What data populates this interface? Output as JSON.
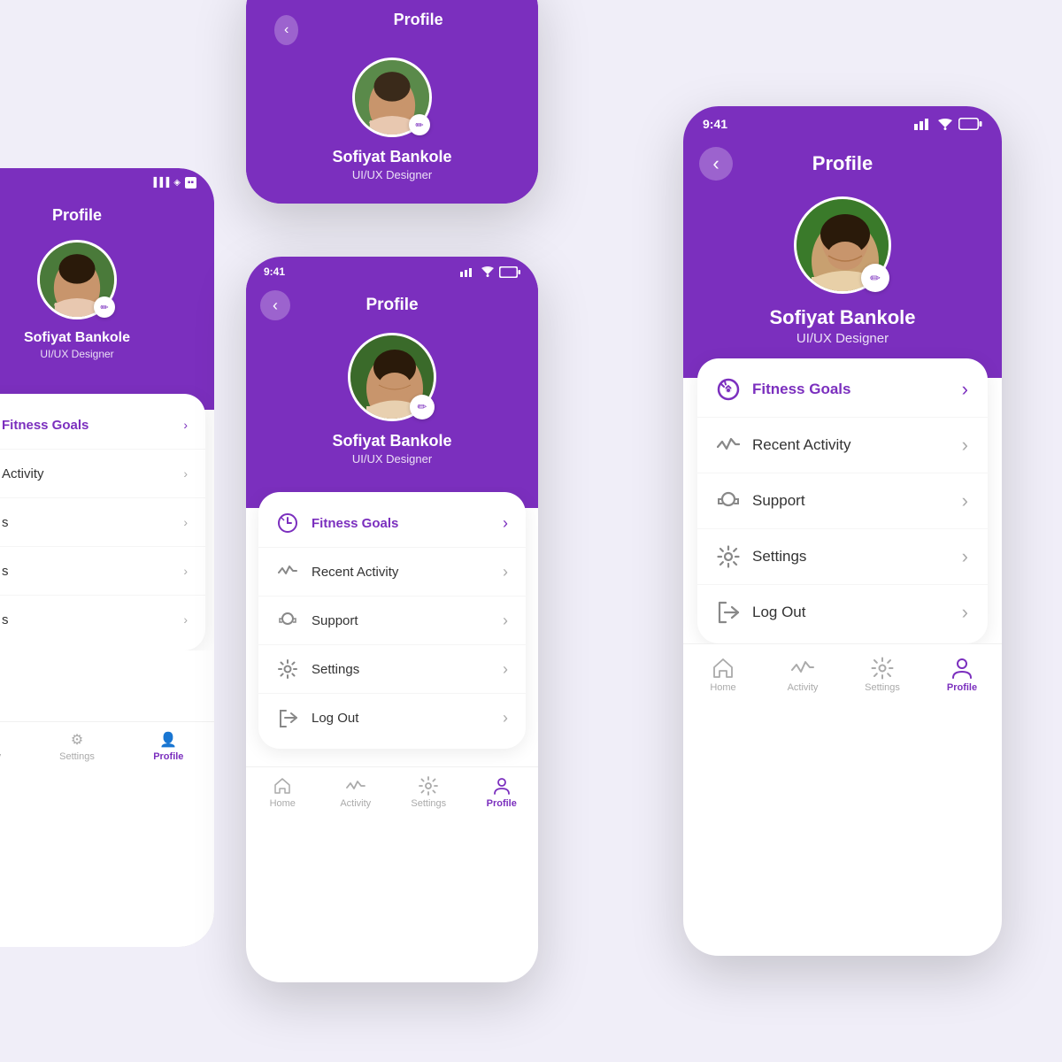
{
  "app": {
    "status_time": "9:41",
    "title": "Profile",
    "back_label": "‹",
    "user": {
      "name": "Sofiyat Bankole",
      "role": "UI/UX Designer"
    },
    "menu_items": [
      {
        "id": "fitness-goals",
        "label": "Fitness Goals",
        "icon": "🎯",
        "purple": true
      },
      {
        "id": "recent-activity",
        "label": "Recent Activity",
        "icon": "📈",
        "purple": false
      },
      {
        "id": "support",
        "label": "Support",
        "icon": "🎧",
        "purple": false
      },
      {
        "id": "settings",
        "label": "Settings",
        "icon": "⚙️",
        "purple": false
      },
      {
        "id": "logout",
        "label": "Log Out",
        "icon": "🚪",
        "purple": false
      }
    ],
    "nav_items": [
      {
        "id": "home",
        "label": "Home",
        "icon": "⌂",
        "active": false
      },
      {
        "id": "activity",
        "label": "Activity",
        "icon": "∿",
        "active": false
      },
      {
        "id": "settings",
        "label": "Settings",
        "icon": "⚙",
        "active": false
      },
      {
        "id": "profile",
        "label": "Profile",
        "icon": "👤",
        "active": true
      }
    ],
    "colors": {
      "purple": "#7b2fbe",
      "bg": "#f0eef8"
    }
  }
}
